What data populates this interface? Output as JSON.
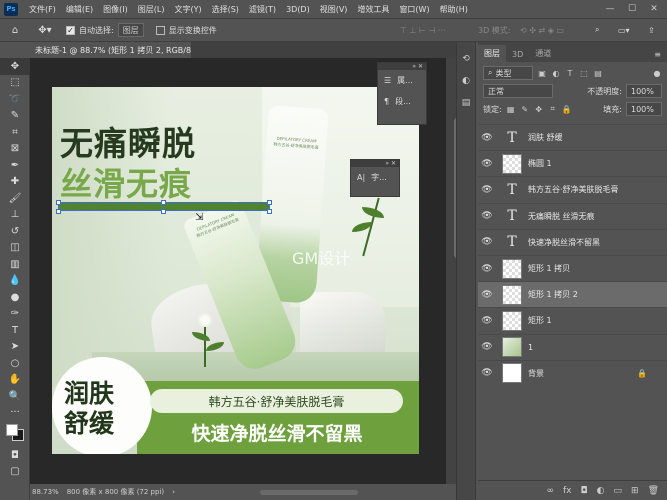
{
  "app": {
    "logo": "Ps"
  },
  "menu": [
    "文件(F)",
    "编辑(E)",
    "图像(I)",
    "图层(L)",
    "文字(Y)",
    "选择(S)",
    "滤镜(T)",
    "3D(D)",
    "视图(V)",
    "增效工具",
    "窗口(W)",
    "帮助(H)"
  ],
  "window_controls": {
    "minimize": "—",
    "maximize": "☐",
    "close": "✕"
  },
  "options": {
    "auto_select_label": "自动选择:",
    "auto_select_value": "图层",
    "show_transform_label": "显示变换控件",
    "mode_3d_label": "3D 模式:",
    "more": "···"
  },
  "document": {
    "tab_title": "未标题-1 @ 88.7% (矩形 1 拷贝 2, RGB/8#) *",
    "tab_close": "×",
    "zoom": "88.73%",
    "size_info": "800 像素 x 800 像素 (72 ppi)",
    "status_arrow": "›"
  },
  "artwork": {
    "headline1": "无痛瞬脱",
    "headline2": "丝滑无痕",
    "watermark": "GM设计",
    "badge_line1": "润肤",
    "badge_line2": "舒缓",
    "pill_text": "韩方五谷·舒净美肤脱毛膏",
    "tagline": "快速净脱丝滑不留黑",
    "tube_label": "DEPILATORY CREAM",
    "tube_small_text": "韩方五谷·舒净美肤脱毛膏"
  },
  "float_panels": {
    "properties_short": "属...",
    "paragraph_short": "段...",
    "character_short": "字..."
  },
  "layers_panel": {
    "tabs": [
      "图层",
      "3D",
      "通道"
    ],
    "kind_label": "类型",
    "blend_mode": "正常",
    "opacity_label": "不透明度:",
    "opacity_value": "100%",
    "lock_label": "锁定:",
    "fill_label": "填充:",
    "fill_value": "100%",
    "layers": [
      {
        "name": "润肤 舒缓",
        "thumb": "text"
      },
      {
        "name": "椭圆 1",
        "thumb": "checker"
      },
      {
        "name": "韩方五谷·舒净美肤脱毛膏",
        "thumb": "text"
      },
      {
        "name": "无痛瞬脱 丝滑无痕",
        "thumb": "text"
      },
      {
        "name": "快速净脱丝滑不留黑",
        "thumb": "text"
      },
      {
        "name": "矩形 1 拷贝",
        "thumb": "checker"
      },
      {
        "name": "矩形 1 拷贝 2",
        "thumb": "checker",
        "selected": true
      },
      {
        "name": "矩形 1",
        "thumb": "checker"
      },
      {
        "name": "1",
        "thumb": "photo"
      },
      {
        "name": "背景",
        "thumb": "white",
        "locked": true
      }
    ],
    "footer_icons": [
      "link-icon",
      "fx-icon",
      "mask-icon",
      "adjustment-icon",
      "group-icon",
      "new-layer-icon",
      "trash-icon"
    ]
  },
  "colors": {
    "ui_bg": "#535353",
    "canvas_bg": "#282828",
    "brand_green": "#6ea13e",
    "dark_green": "#253a1f",
    "light_green": "#79a84b",
    "selection_blue": "#3c6fc9"
  }
}
